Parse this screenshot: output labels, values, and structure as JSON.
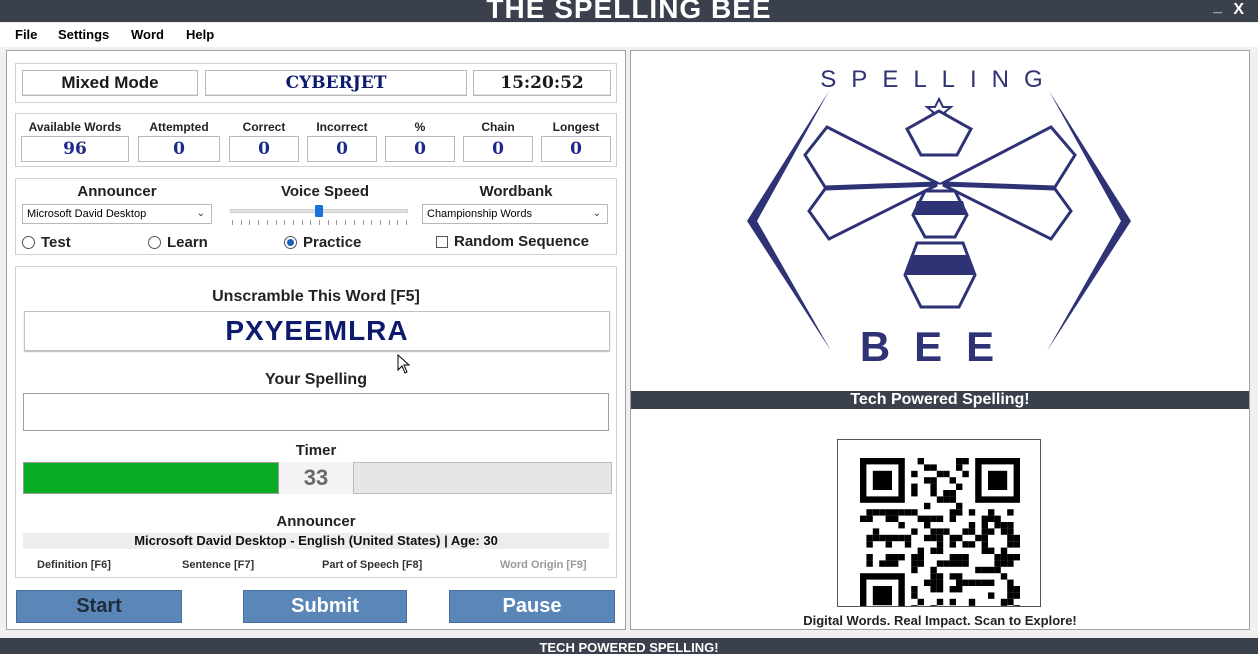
{
  "window": {
    "title": "THE SPELLING BEE",
    "minimize": "_",
    "close": "X"
  },
  "menu": [
    "File",
    "Settings",
    "Word",
    "Help"
  ],
  "header": {
    "mode": "Mixed Mode",
    "user": "CYBERJET",
    "clock": "15:20:52"
  },
  "stats": [
    {
      "label": "Available Words",
      "value": "96"
    },
    {
      "label": "Attempted",
      "value": "0"
    },
    {
      "label": "Correct",
      "value": "0"
    },
    {
      "label": "Incorrect",
      "value": "0"
    },
    {
      "label": "%",
      "value": "0"
    },
    {
      "label": "Chain",
      "value": "0"
    },
    {
      "label": "Longest",
      "value": "0"
    }
  ],
  "settings": {
    "announcer_label": "Announcer",
    "announcer_value": "Microsoft David Desktop",
    "voice_speed_label": "Voice Speed",
    "voice_speed_level": 0.5,
    "wordbank_label": "Wordbank",
    "wordbank_value": "Championship Words",
    "modes": [
      "Test",
      "Learn",
      "Practice"
    ],
    "selected_mode": "Practice",
    "random_label": "Random Sequence",
    "random_checked": false
  },
  "word": {
    "prompt": "Unscramble This Word [F5]",
    "scrambled": "PXYEEMLRA",
    "spelling_label": "Your Spelling",
    "spelling_value": "",
    "timer_label": "Timer",
    "timer_value": "33",
    "timer_fraction": 0.44
  },
  "announcer": {
    "label": "Announcer",
    "info": "Microsoft David Desktop - English (United States) | Age: 30"
  },
  "hints": [
    "Definition [F6]",
    "Sentence [F7]",
    "Part of Speech [F8]",
    "Word Origin [F9]"
  ],
  "buttons": {
    "start": "Start",
    "submit": "Submit",
    "pause": "Pause"
  },
  "colors": {
    "navy": "#2e3376",
    "bar": "#3b414c",
    "timer": "#08ad23",
    "button": "#5b86b8"
  },
  "logo": {
    "top_text": "SPELLING",
    "bottom_text": "BEE"
  },
  "right": {
    "banner": "Tech Powered Spelling!",
    "qr_caption": "Digital Words. Real Impact. Scan to Explore!"
  },
  "footer": "TECH POWERED SPELLING!"
}
